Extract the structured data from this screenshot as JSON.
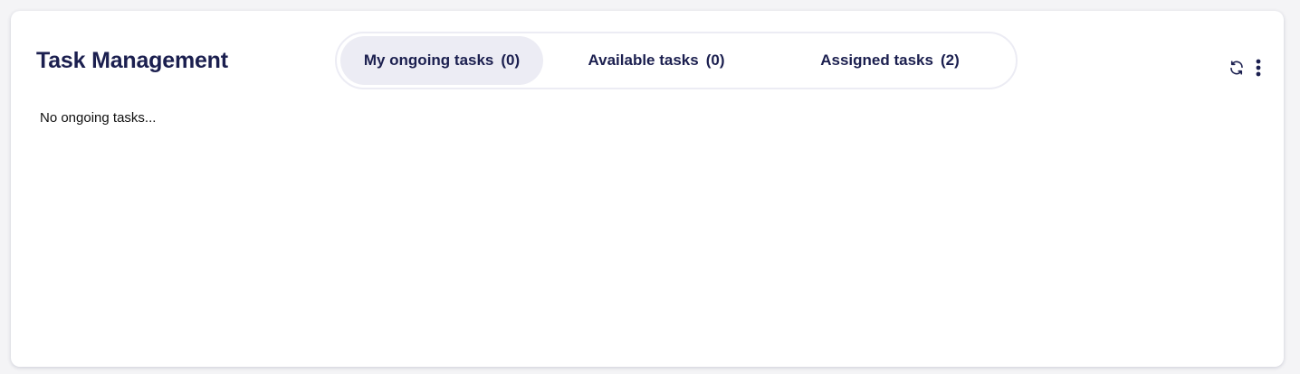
{
  "header": {
    "title": "Task Management"
  },
  "tabs": [
    {
      "label": "My ongoing tasks",
      "count": "(0)",
      "active": true
    },
    {
      "label": "Available tasks",
      "count": "(0)",
      "active": false
    },
    {
      "label": "Assigned tasks",
      "count": "(2)",
      "active": false
    }
  ],
  "actions": {
    "refresh_icon": "refresh-icon",
    "more_icon": "more-vertical-icon"
  },
  "content": {
    "empty_message": "No ongoing tasks..."
  },
  "colors": {
    "title": "#1b1f4f",
    "active_tab_bg": "#ececf4",
    "tabs_border": "#ececf4"
  }
}
